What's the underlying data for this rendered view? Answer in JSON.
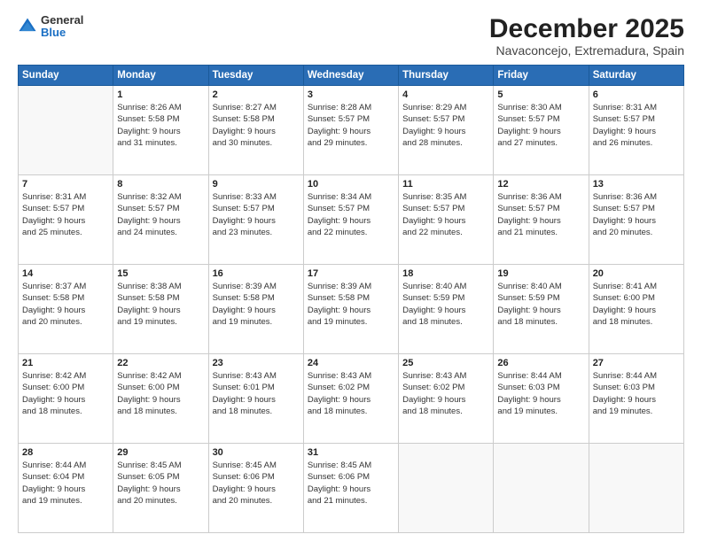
{
  "logo": {
    "general": "General",
    "blue": "Blue"
  },
  "header": {
    "month": "December 2025",
    "location": "Navaconcejo, Extremadura, Spain"
  },
  "days": [
    "Sunday",
    "Monday",
    "Tuesday",
    "Wednesday",
    "Thursday",
    "Friday",
    "Saturday"
  ],
  "weeks": [
    [
      {
        "day": "",
        "lines": []
      },
      {
        "day": "1",
        "lines": [
          "Sunrise: 8:26 AM",
          "Sunset: 5:58 PM",
          "Daylight: 9 hours",
          "and 31 minutes."
        ]
      },
      {
        "day": "2",
        "lines": [
          "Sunrise: 8:27 AM",
          "Sunset: 5:58 PM",
          "Daylight: 9 hours",
          "and 30 minutes."
        ]
      },
      {
        "day": "3",
        "lines": [
          "Sunrise: 8:28 AM",
          "Sunset: 5:57 PM",
          "Daylight: 9 hours",
          "and 29 minutes."
        ]
      },
      {
        "day": "4",
        "lines": [
          "Sunrise: 8:29 AM",
          "Sunset: 5:57 PM",
          "Daylight: 9 hours",
          "and 28 minutes."
        ]
      },
      {
        "day": "5",
        "lines": [
          "Sunrise: 8:30 AM",
          "Sunset: 5:57 PM",
          "Daylight: 9 hours",
          "and 27 minutes."
        ]
      },
      {
        "day": "6",
        "lines": [
          "Sunrise: 8:31 AM",
          "Sunset: 5:57 PM",
          "Daylight: 9 hours",
          "and 26 minutes."
        ]
      }
    ],
    [
      {
        "day": "7",
        "lines": [
          "Sunrise: 8:31 AM",
          "Sunset: 5:57 PM",
          "Daylight: 9 hours",
          "and 25 minutes."
        ]
      },
      {
        "day": "8",
        "lines": [
          "Sunrise: 8:32 AM",
          "Sunset: 5:57 PM",
          "Daylight: 9 hours",
          "and 24 minutes."
        ]
      },
      {
        "day": "9",
        "lines": [
          "Sunrise: 8:33 AM",
          "Sunset: 5:57 PM",
          "Daylight: 9 hours",
          "and 23 minutes."
        ]
      },
      {
        "day": "10",
        "lines": [
          "Sunrise: 8:34 AM",
          "Sunset: 5:57 PM",
          "Daylight: 9 hours",
          "and 22 minutes."
        ]
      },
      {
        "day": "11",
        "lines": [
          "Sunrise: 8:35 AM",
          "Sunset: 5:57 PM",
          "Daylight: 9 hours",
          "and 22 minutes."
        ]
      },
      {
        "day": "12",
        "lines": [
          "Sunrise: 8:36 AM",
          "Sunset: 5:57 PM",
          "Daylight: 9 hours",
          "and 21 minutes."
        ]
      },
      {
        "day": "13",
        "lines": [
          "Sunrise: 8:36 AM",
          "Sunset: 5:57 PM",
          "Daylight: 9 hours",
          "and 20 minutes."
        ]
      }
    ],
    [
      {
        "day": "14",
        "lines": [
          "Sunrise: 8:37 AM",
          "Sunset: 5:58 PM",
          "Daylight: 9 hours",
          "and 20 minutes."
        ]
      },
      {
        "day": "15",
        "lines": [
          "Sunrise: 8:38 AM",
          "Sunset: 5:58 PM",
          "Daylight: 9 hours",
          "and 19 minutes."
        ]
      },
      {
        "day": "16",
        "lines": [
          "Sunrise: 8:39 AM",
          "Sunset: 5:58 PM",
          "Daylight: 9 hours",
          "and 19 minutes."
        ]
      },
      {
        "day": "17",
        "lines": [
          "Sunrise: 8:39 AM",
          "Sunset: 5:58 PM",
          "Daylight: 9 hours",
          "and 19 minutes."
        ]
      },
      {
        "day": "18",
        "lines": [
          "Sunrise: 8:40 AM",
          "Sunset: 5:59 PM",
          "Daylight: 9 hours",
          "and 18 minutes."
        ]
      },
      {
        "day": "19",
        "lines": [
          "Sunrise: 8:40 AM",
          "Sunset: 5:59 PM",
          "Daylight: 9 hours",
          "and 18 minutes."
        ]
      },
      {
        "day": "20",
        "lines": [
          "Sunrise: 8:41 AM",
          "Sunset: 6:00 PM",
          "Daylight: 9 hours",
          "and 18 minutes."
        ]
      }
    ],
    [
      {
        "day": "21",
        "lines": [
          "Sunrise: 8:42 AM",
          "Sunset: 6:00 PM",
          "Daylight: 9 hours",
          "and 18 minutes."
        ]
      },
      {
        "day": "22",
        "lines": [
          "Sunrise: 8:42 AM",
          "Sunset: 6:00 PM",
          "Daylight: 9 hours",
          "and 18 minutes."
        ]
      },
      {
        "day": "23",
        "lines": [
          "Sunrise: 8:43 AM",
          "Sunset: 6:01 PM",
          "Daylight: 9 hours",
          "and 18 minutes."
        ]
      },
      {
        "day": "24",
        "lines": [
          "Sunrise: 8:43 AM",
          "Sunset: 6:02 PM",
          "Daylight: 9 hours",
          "and 18 minutes."
        ]
      },
      {
        "day": "25",
        "lines": [
          "Sunrise: 8:43 AM",
          "Sunset: 6:02 PM",
          "Daylight: 9 hours",
          "and 18 minutes."
        ]
      },
      {
        "day": "26",
        "lines": [
          "Sunrise: 8:44 AM",
          "Sunset: 6:03 PM",
          "Daylight: 9 hours",
          "and 19 minutes."
        ]
      },
      {
        "day": "27",
        "lines": [
          "Sunrise: 8:44 AM",
          "Sunset: 6:03 PM",
          "Daylight: 9 hours",
          "and 19 minutes."
        ]
      }
    ],
    [
      {
        "day": "28",
        "lines": [
          "Sunrise: 8:44 AM",
          "Sunset: 6:04 PM",
          "Daylight: 9 hours",
          "and 19 minutes."
        ]
      },
      {
        "day": "29",
        "lines": [
          "Sunrise: 8:45 AM",
          "Sunset: 6:05 PM",
          "Daylight: 9 hours",
          "and 20 minutes."
        ]
      },
      {
        "day": "30",
        "lines": [
          "Sunrise: 8:45 AM",
          "Sunset: 6:06 PM",
          "Daylight: 9 hours",
          "and 20 minutes."
        ]
      },
      {
        "day": "31",
        "lines": [
          "Sunrise: 8:45 AM",
          "Sunset: 6:06 PM",
          "Daylight: 9 hours",
          "and 21 minutes."
        ]
      },
      {
        "day": "",
        "lines": []
      },
      {
        "day": "",
        "lines": []
      },
      {
        "day": "",
        "lines": []
      }
    ]
  ]
}
